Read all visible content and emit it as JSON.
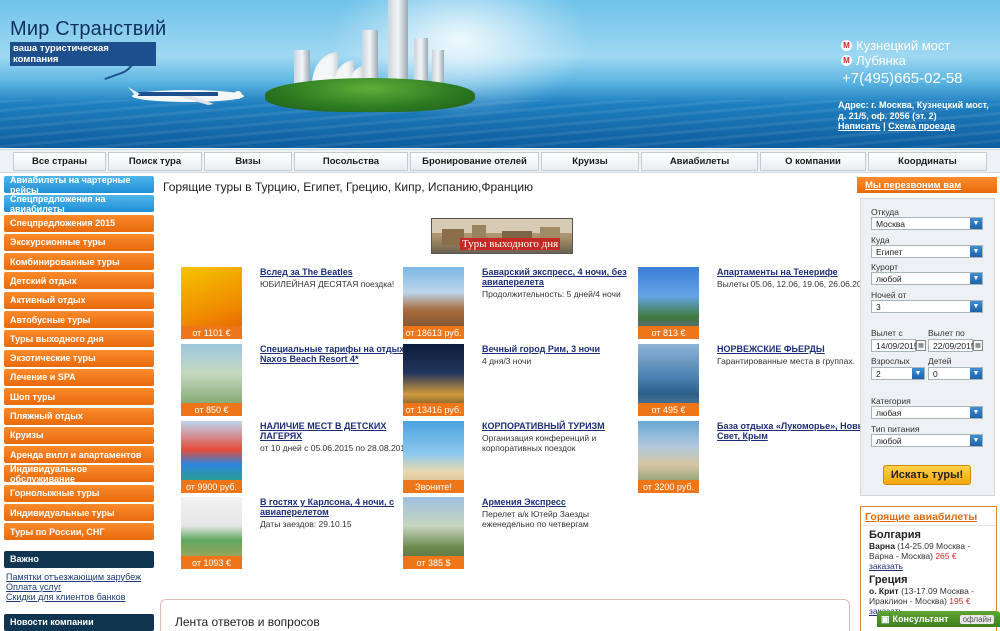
{
  "header": {
    "logo_title": "Мир Странствий",
    "logo_subtitle": "ваша туристическая компания",
    "metro": [
      "Кузнецкий мост",
      "Лубянка"
    ],
    "metro_icon": "М",
    "phone": "+7(495)665-02-58",
    "address": "Адрес: г. Москва, Кузнецкий мост, д. 21/5, оф. 2056 (эт. 2)",
    "link_write": "Написать",
    "link_sep": "|",
    "link_map": "Схема проезда"
  },
  "nav": [
    "Все страны",
    "Поиск тура",
    "Визы",
    "Посольства",
    "Бронирование отелей",
    "Круизы",
    "Авиабилеты",
    "О компании",
    "Координаты"
  ],
  "sidebar": {
    "blue_items": [
      "Авиабилеты на чартерные рейсы",
      "Спецпредложения на авиабилеты"
    ],
    "orange_items": [
      "Спецпредложения 2015",
      "Экскурсионные туры",
      "Комбинированные туры",
      "Детский отдых",
      "Активный отдых",
      "Автобусные туры",
      "Туры выходного дня",
      "Экзотические туры",
      "Лечение и SPA",
      "Шоп туры",
      "Пляжный отдых",
      "Круизы",
      "Аренда вилл и апартаментов",
      "Индивидуальное обслуживание",
      "Горнолыжные туры",
      "Индивидуальные туры",
      "Туры по России, СНГ"
    ],
    "important_title": "Важно",
    "important_links": [
      "Памятки отъезжающим зарубеж",
      "Оплата услуг",
      "Скидки для клиентов банков"
    ],
    "news_title": "Новости компании"
  },
  "main": {
    "title": "Горящие туры в Турцию, Египет, Грецию, Кипр, Испанию,Францию",
    "banner_text": "Туры выходного дня",
    "tours": [
      {
        "title": "Вслед за The Beatles",
        "desc": "ЮБИЛЕЙНАЯ ДЕСЯТАЯ поездка!",
        "price": "от 1101 €"
      },
      {
        "title": "Баварский экспресс, 4 ночи, без авиаперелета",
        "desc": "Продолжительность: 5 дней/4 ночи",
        "price": "от 18613 руб."
      },
      {
        "title": "Апартаменты на Тенерифе",
        "desc": "Вылеты 05.06, 12.06, 19.06, 26.06.2015",
        "price": "от 813 €"
      },
      {
        "title": "Специальные тарифы на отдых в Naxos Beach Resort 4*",
        "desc": "",
        "price": "от 850 €"
      },
      {
        "title": "Вечный город Рим, 3 ночи",
        "desc": "4 дня/3 ночи",
        "price": "от 13416 руб."
      },
      {
        "title": "НОРВЕЖСКИЕ ФЬЕРДЫ",
        "desc": "Гарантированные места в группах.",
        "price": "от 495 €"
      },
      {
        "title": "НАЛИЧИЕ МЕСТ В ДЕТСКИХ ЛАГЕРЯХ",
        "desc": "от 10 дней с 05.06.2015 по 28.08.2015",
        "price": "от 9900 руб."
      },
      {
        "title": "КОРПОРАТИВНЫЙ ТУРИЗМ",
        "desc": "Организация конференций и корпоративных поездок",
        "price": "Звоните!"
      },
      {
        "title": "База отдыха «Лукоморье», Новый Свет, Крым",
        "desc": "",
        "price": "от 3200 руб."
      },
      {
        "title": "В гостях у Карлсона, 4 ночи, с авиаперелетом",
        "desc": "Даты заездов: 29.10.15",
        "price": "от 1093 €"
      },
      {
        "title": "Армения Экспресс",
        "desc": "Перелет а/к Ютейр Заезды еженедельно по четвергам",
        "price": "от 385 $"
      }
    ],
    "feed_title": "Лента ответов и вопросов"
  },
  "right": {
    "callback": "Мы перезвоним вам",
    "search": {
      "from_label": "Откуда",
      "from_value": "Москва",
      "to_label": "Куда",
      "to_value": "Египет",
      "resort_label": "Курорт",
      "resort_value": "любой",
      "nights_label": "Ночей от",
      "nights_value": "3",
      "depart_from_label": "Вылет с",
      "depart_from_value": "14/09/2015",
      "depart_to_label": "Вылет по",
      "depart_to_value": "22/09/2015",
      "adults_label": "Взрослых",
      "adults_value": "2",
      "children_label": "Детей",
      "children_value": "0",
      "category_label": "Категория",
      "category_value": "любая",
      "meal_label": "Тип питания",
      "meal_value": "любой",
      "button": "Искать туры!"
    },
    "hot_flights": {
      "title": "Горящие авиабилеты",
      "items": [
        {
          "country": "Болгария",
          "city": "Варна",
          "detail": "(14-25.09 Москва - Варна - Москва)",
          "price": "265 €",
          "order": "заказать"
        },
        {
          "country": "Греция",
          "city": "о. Крит",
          "detail": "(13-17.09 Москва - Ираклион - Москва)",
          "price": "195 €",
          "order": "заказать"
        }
      ]
    },
    "consultant": "Консультант",
    "consultant_status": "офлайн"
  },
  "colors": {
    "orange": "#e86a0b",
    "blue": "#1f8fd4",
    "navy": "#0f3551",
    "link": "#1c2f77",
    "price_red": "#d2242a"
  }
}
